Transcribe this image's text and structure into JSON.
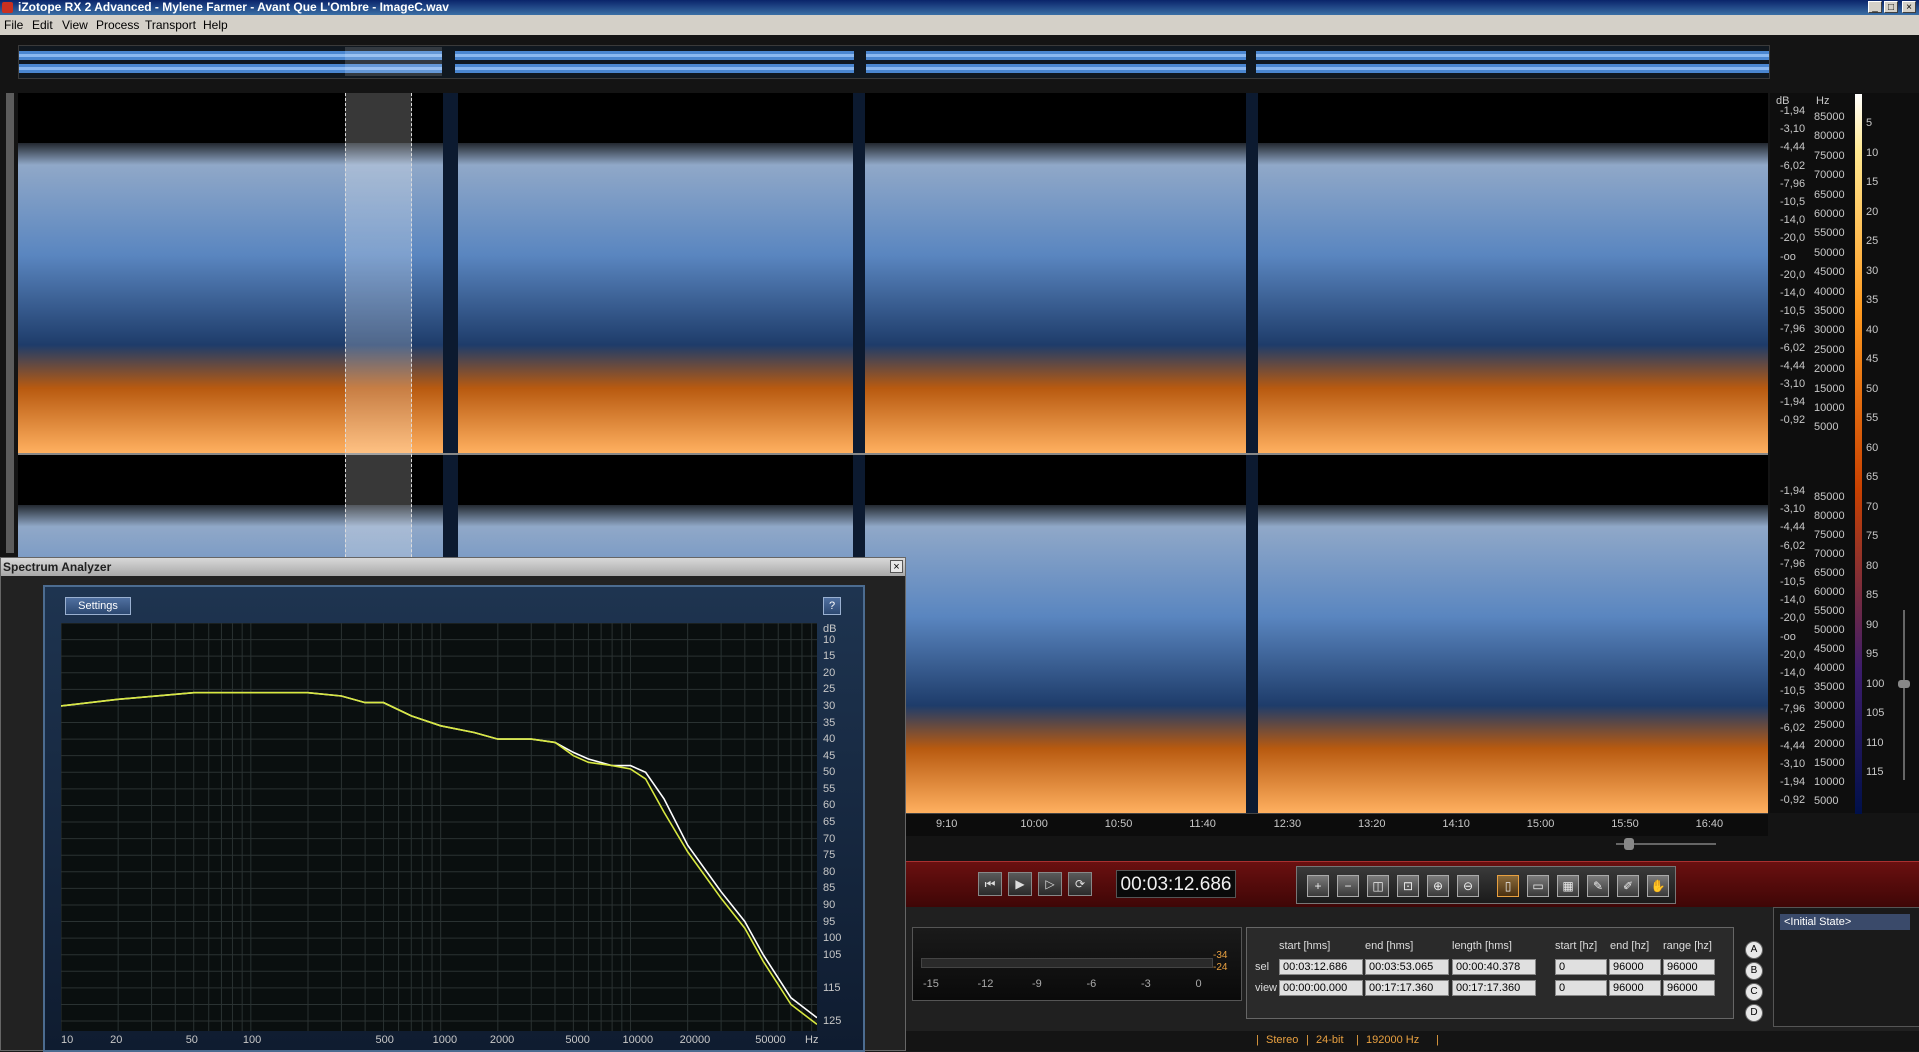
{
  "window": {
    "title": "iZotope RX 2 Advanced - Mylene Farmer - Avant Que L'Ombre - ImageC.wav"
  },
  "menu": [
    "File",
    "Edit",
    "View",
    "Process",
    "Transport",
    "Help"
  ],
  "freq_scale": {
    "unit_db": "dB",
    "unit_hz": "Hz",
    "ch1_db": [
      "-1,94",
      "-3,10",
      "-4,44",
      "-6,02",
      "-7,96",
      "-10,5",
      "-14,0",
      "-20,0",
      "-oo",
      "-20,0",
      "-14,0",
      "-10,5",
      "-7,96",
      "-6,02",
      "-4,44",
      "-3,10",
      "-1,94",
      "-0,92"
    ],
    "ch1_hz": [
      "85000",
      "80000",
      "75000",
      "70000",
      "65000",
      "60000",
      "55000",
      "50000",
      "45000",
      "40000",
      "35000",
      "30000",
      "25000",
      "20000",
      "15000",
      "10000",
      "5000"
    ],
    "ch2_db": [
      "-1,94",
      "-3,10",
      "-4,44",
      "-6,02",
      "-7,96",
      "-10,5",
      "-14,0",
      "-20,0",
      "-oo",
      "-20,0",
      "-14,0",
      "-10,5",
      "-7,96",
      "-6,02",
      "-4,44",
      "-3,10",
      "-1,94",
      "-0,92"
    ],
    "ch2_hz": [
      "85000",
      "80000",
      "75000",
      "70000",
      "65000",
      "60000",
      "55000",
      "50000",
      "45000",
      "40000",
      "35000",
      "30000",
      "25000",
      "20000",
      "15000",
      "10000",
      "5000"
    ],
    "colorbar": [
      "5",
      "10",
      "15",
      "20",
      "25",
      "30",
      "35",
      "40",
      "45",
      "50",
      "55",
      "60",
      "65",
      "70",
      "75",
      "80",
      "85",
      "90",
      "95",
      "100",
      "105",
      "110",
      "115"
    ]
  },
  "timeline": [
    "9:10",
    "10:00",
    "10:50",
    "11:40",
    "12:30",
    "13:20",
    "14:10",
    "15:00",
    "15:50",
    "16:40"
  ],
  "spectrum_analyzer": {
    "title": "Spectrum Analyzer",
    "close": "×",
    "settings_label": "Settings",
    "help_label": "?",
    "db_unit": "dB",
    "db_ticks": [
      "10",
      "15",
      "20",
      "25",
      "30",
      "35",
      "40",
      "45",
      "50",
      "55",
      "60",
      "65",
      "70",
      "75",
      "80",
      "85",
      "90",
      "95",
      "100",
      "105",
      "115",
      "125"
    ],
    "freq_ticks": [
      "10",
      "20",
      "50",
      "100",
      "500",
      "1000",
      "2000",
      "5000",
      "10000",
      "20000",
      "50000",
      "Hz"
    ]
  },
  "chart_data": {
    "type": "line",
    "xlabel": "Hz",
    "ylabel": "dB",
    "x_scale": "log",
    "xlim": [
      10,
      96000
    ],
    "ylim": [
      5,
      128
    ],
    "series": [
      {
        "x": [
          10,
          20,
          50,
          100,
          200,
          300,
          400,
          500,
          700,
          1000,
          1500,
          2000,
          3000,
          4000,
          5000,
          6000,
          8000,
          10000,
          12000,
          15000,
          20000,
          30000,
          40000,
          50000,
          70000,
          96000
        ],
        "y": [
          30,
          28,
          26,
          26,
          26,
          27,
          29,
          29,
          33,
          36,
          38,
          40,
          40,
          41,
          44,
          46,
          48,
          48,
          50,
          58,
          72,
          86,
          95,
          105,
          118,
          124
        ]
      },
      {
        "x": [
          10,
          20,
          50,
          100,
          200,
          300,
          400,
          500,
          700,
          1000,
          1500,
          2000,
          3000,
          4000,
          5000,
          6000,
          8000,
          10000,
          12000,
          15000,
          20000,
          30000,
          40000,
          50000,
          70000,
          96000
        ],
        "y": [
          30,
          28,
          26,
          26,
          26,
          27,
          29,
          29,
          33,
          36,
          38,
          40,
          40,
          41,
          45,
          47,
          48,
          49,
          52,
          62,
          74,
          88,
          97,
          107,
          120,
          126
        ]
      }
    ]
  },
  "transport": {
    "time": "00:03:12.686",
    "buttons": [
      "skip-back",
      "play",
      "play-selection",
      "loop"
    ]
  },
  "meter": {
    "ticks": [
      "-15",
      "-12",
      "-9",
      "-6",
      "-3",
      "0"
    ],
    "peak_top": "-34",
    "peak_bottom": "-24"
  },
  "selection": {
    "headers": [
      "start [hms]",
      "end [hms]",
      "length [hms]",
      "start [hz]",
      "end [hz]",
      "range [hz]"
    ],
    "sel_label": "sel",
    "view_label": "view",
    "sel": [
      "00:03:12.686",
      "00:03:53.065",
      "00:00:40.378",
      "0",
      "96000",
      "96000"
    ],
    "view": [
      "00:00:00.000",
      "00:17:17.360",
      "00:17:17.360",
      "0",
      "96000",
      "96000"
    ]
  },
  "snapshots": [
    "A",
    "B",
    "C",
    "D"
  ],
  "history": {
    "item": "<Initial State>"
  },
  "status": {
    "channels": "Stereo",
    "bitdepth": "24-bit",
    "rate": "192000 Hz"
  },
  "colors": {
    "accent": "#e8a040",
    "spectro_blue": "#5a8ac8",
    "spectro_orange": "#ff8c20"
  }
}
